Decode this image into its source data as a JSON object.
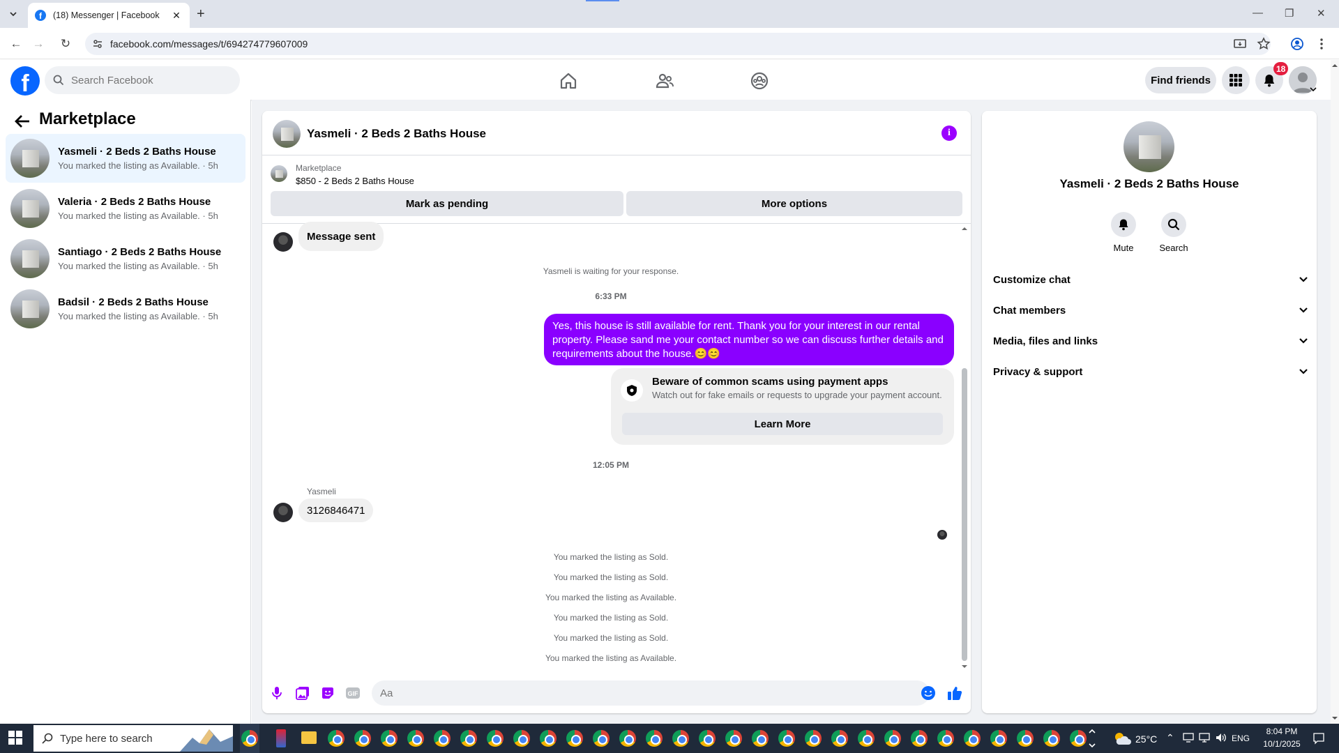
{
  "browser": {
    "tab_title": "(18) Messenger | Facebook",
    "new_tab_symbol": "+",
    "url": "facebook.com/messages/t/694274779607009"
  },
  "header": {
    "search_placeholder": "Search Facebook",
    "find_friends": "Find friends",
    "notification_count": "18",
    "nav_icons": [
      "home-icon",
      "friends-icon",
      "groups-icon"
    ]
  },
  "left": {
    "title": "Marketplace",
    "conversations": [
      {
        "name": "Yasmeli · 2 Beds 2 Baths House",
        "sub": "You marked the listing as Available. · 5h",
        "active": true
      },
      {
        "name": "Valeria · 2 Beds 2 Baths House",
        "sub": "You marked the listing as Available. · 5h",
        "active": false
      },
      {
        "name": "Santiago · 2 Beds 2 Baths House",
        "sub": "You marked the listing as Available. · 5h",
        "active": false
      },
      {
        "name": "Badsil · 2 Beds 2 Baths House",
        "sub": "You marked the listing as Available. · 5h",
        "active": false
      }
    ]
  },
  "chat": {
    "title": "Yasmeli · 2 Beds 2 Baths House",
    "marketplace_label": "Marketplace",
    "listing": "$850 - 2 Beds 2 Baths House",
    "mark_pending": "Mark as pending",
    "more_options": "More options",
    "msg_sent": "Message sent",
    "waiting": "Yasmeli is waiting for your response.",
    "time1": "6:33 PM",
    "outgoing": "Yes, this house is still available for rent. Thank you for your interest in our rental property. Please sand me your contact number so we can discuss further details and requirements about the house.😊😊",
    "scam_title": "Beware of common scams using payment apps",
    "scam_sub": "Watch out for fake emails or requests to upgrade your payment account.",
    "learn_more": "Learn More",
    "time2": "12:05 PM",
    "sender": "Yasmeli",
    "incoming": "3126846471",
    "system": [
      "You marked the listing as Sold.",
      "You marked the listing as Sold.",
      "You marked the listing as Available.",
      "You marked the listing as Sold.",
      "You marked the listing as Sold.",
      "You marked the listing as Available."
    ],
    "composer_placeholder": "Aa"
  },
  "right": {
    "name": "Yasmeli · 2 Beds 2 Baths House",
    "mute": "Mute",
    "search": "Search",
    "rows": [
      "Customize chat",
      "Chat members",
      "Media, files and links",
      "Privacy & support"
    ]
  },
  "taskbar": {
    "search_placeholder": "Type here to search",
    "temp": "25°C",
    "lang": "ENG",
    "time": "8:04 PM",
    "date": "10/1/2025"
  },
  "colors": {
    "brand": "#0866ff",
    "accent": "#8a00ff",
    "badge": "#e41e3f"
  }
}
